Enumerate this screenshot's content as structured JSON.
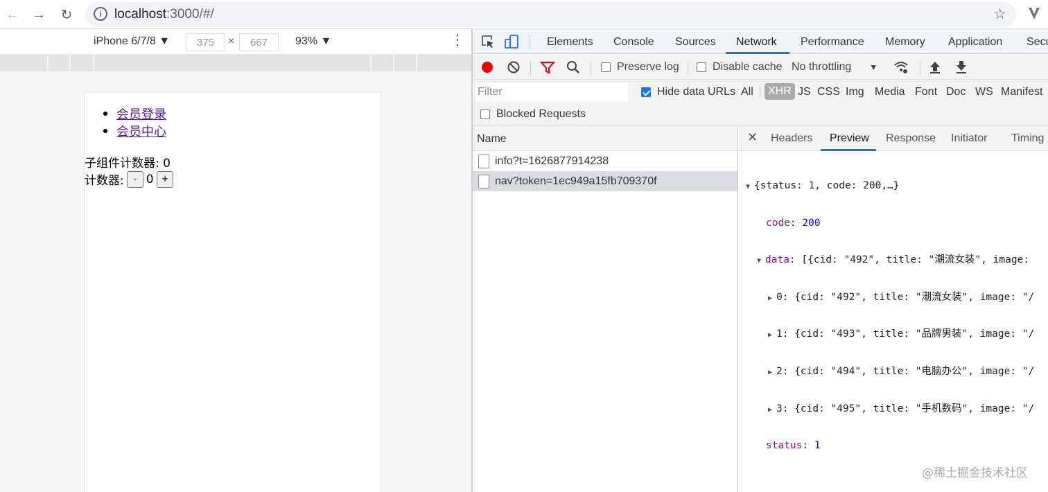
{
  "browser": {
    "url_host": "localhost",
    "url_path": ":3000/#/",
    "info_icon": "i"
  },
  "device_toolbar": {
    "device": "iPhone 6/7/8 ▼",
    "width": "375",
    "height": "667",
    "times": "×",
    "zoom": "93% ▼"
  },
  "page": {
    "links": [
      "会员登录",
      "会员中心"
    ],
    "child_counter_label": "子组件计数器: 0",
    "counter_label": "计数器:",
    "minus": "-",
    "count": "0",
    "plus": "+"
  },
  "devtools": {
    "tabs": [
      "Elements",
      "Console",
      "Sources",
      "Network",
      "Performance",
      "Memory",
      "Application",
      "Secu"
    ],
    "active_tab": "Network",
    "toolbar": {
      "preserve_log": "Preserve log",
      "disable_cache": "Disable cache",
      "throttling": "No throttling"
    },
    "filter_placeholder": "Filter",
    "hide_data_urls": "Hide data URLs",
    "types": [
      "All",
      "XHR",
      "JS",
      "CSS",
      "Img",
      "Media",
      "Font",
      "Doc",
      "WS",
      "Manifest"
    ],
    "active_type": "XHR",
    "blocked_requests": "Blocked Requests",
    "name_header": "Name",
    "requests": [
      "info?t=1626877914238",
      "nav?token=1ec949a15fb709370f"
    ],
    "detail_tabs": [
      "Headers",
      "Preview",
      "Response",
      "Initiator",
      "Timing"
    ],
    "active_detail_tab": "Preview",
    "preview": {
      "root": "{status: 1, code: 200,…}",
      "code_key": "code",
      "code_val": "200",
      "data_key": "data",
      "data_summary": "[{cid: \"492\", title: \"潮流女装\", image: ",
      "items": [
        "0: {cid: \"492\", title: \"潮流女装\", image: \"/",
        "1: {cid: \"493\", title: \"品牌男装\", image: \"/",
        "2: {cid: \"494\", title: \"电脑办公\", image: \"/",
        "3: {cid: \"495\", title: \"手机数码\", image: \"/"
      ],
      "status_key": "status",
      "status_val": "1"
    }
  },
  "watermark": "@稀土掘金技术社区"
}
